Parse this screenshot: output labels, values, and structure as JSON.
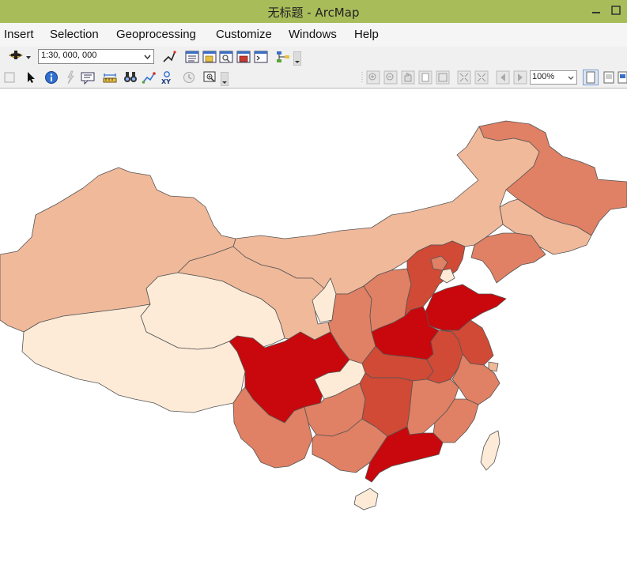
{
  "window": {
    "title": "无标题 - ArcMap"
  },
  "menu": {
    "items": [
      "Insert",
      "Selection",
      "Geoprocessing",
      "Customize",
      "Windows",
      "Help"
    ]
  },
  "toolbar": {
    "scale_value": "1:30, 000, 000",
    "zoom_value": "100%"
  },
  "map": {
    "colors": {
      "class1": "#fdebd7",
      "class2": "#f0b99a",
      "class3": "#e08064",
      "class4": "#d04a36",
      "class5": "#c8080c"
    }
  }
}
